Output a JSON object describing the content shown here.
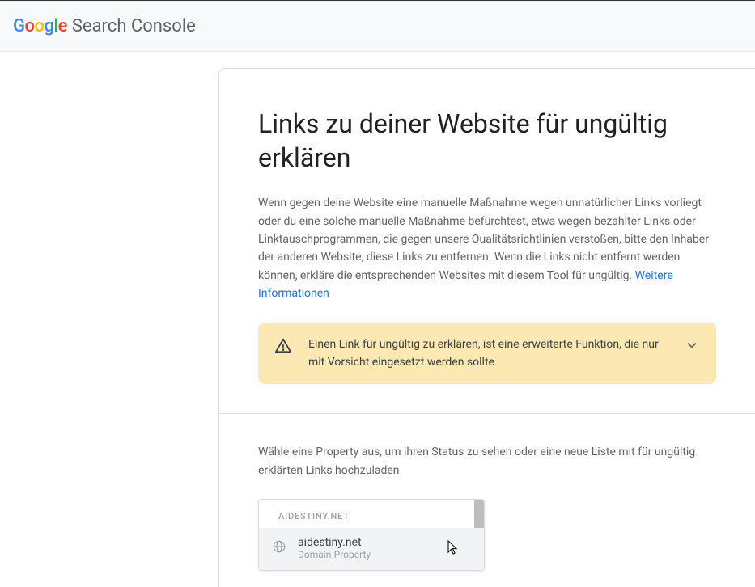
{
  "header": {
    "logo_letters": {
      "g1": "G",
      "o1": "o",
      "o2": "o",
      "g2": "g",
      "l": "l",
      "e": "e"
    },
    "product_name": "Search Console"
  },
  "main": {
    "title": "Links zu deiner Website für ungültig erklären",
    "description_part1": "Wenn gegen deine Website eine manuelle Maßnahme wegen unnatürlicher Links vorliegt oder du eine solche manuelle Maßnahme befürchtest, etwa wegen bezahlter Links oder Linktauschprogrammen, die gegen unsere Qualitätsrichtlinien verstoßen, bitte den Inhaber der anderen Website, diese Links zu entfernen. Wenn die Links nicht entfernt werden können, erkläre die entsprechenden Websites mit diesem Tool für ungültig. ",
    "more_info_link": "Weitere Informationen",
    "warning_text": "Einen Link für ungültig zu erklären, ist eine erweiterte Funktion, die nur mit Vorsicht eingesetzt werden sollte",
    "prompt": "Wähle eine Property aus, um ihren Status zu sehen oder eine neue Liste mit für ungültig erklärten Links hochzuladen"
  },
  "dropdown": {
    "group_header": "AIDESTINY.NET",
    "items": [
      {
        "title": "aidestiny.net",
        "subtitle": "Domain-Property"
      }
    ]
  }
}
